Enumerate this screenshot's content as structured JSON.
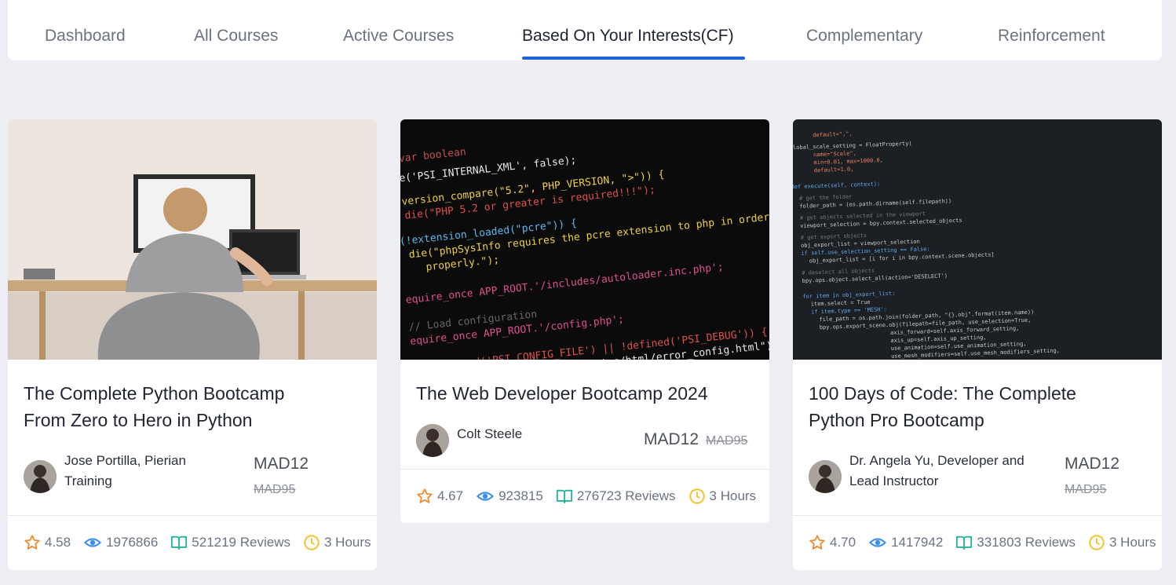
{
  "tabs": [
    {
      "label": "Dashboard"
    },
    {
      "label": "All Courses"
    },
    {
      "label": "Active Courses"
    },
    {
      "label": "Based On Your Interests(CF)"
    },
    {
      "label": "Complementary"
    },
    {
      "label": "Reinforcement"
    }
  ],
  "active_tab": "Based On Your Interests(CF)",
  "accent_color": "#1a63d8",
  "courses": [
    {
      "title_line1": "The Complete Python Bootcamp",
      "title_line2": "From Zero to Hero in Python",
      "instructor_line1": "Jose Portilla, Pierian",
      "instructor_line2": "Training",
      "price": "MAD12",
      "old_price": "MAD95",
      "rating": "4.58",
      "views": "1976866",
      "reviews": "521219 Reviews",
      "duration": "3 Hours"
    },
    {
      "title_line1": "The Web Developer Bootcamp 2024",
      "instructor_line1": "Colt Steele",
      "price": "MAD12",
      "old_price": "MAD95",
      "rating": "4.67",
      "views": "923815",
      "reviews": "276723 Reviews",
      "duration": "3 Hours"
    },
    {
      "title_line1": "100 Days of Code: The Complete",
      "title_line2": "Python Pro Bootcamp",
      "instructor_line1": "Dr. Angela Yu, Developer and",
      "instructor_line2": "Lead Instructor",
      "price": "MAD12",
      "old_price": "MAD95",
      "rating": "4.70",
      "views": "1417942",
      "reviews": "331803 Reviews",
      "duration": "3 Hours"
    }
  ],
  "icons": {
    "rating": "star-icon",
    "views": "eye-icon",
    "reviews": "book-icon",
    "duration": "clock-icon"
  }
}
